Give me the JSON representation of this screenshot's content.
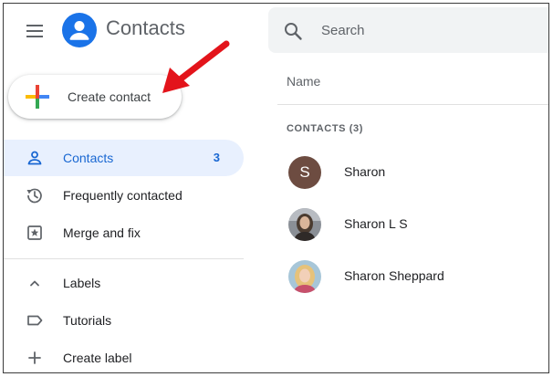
{
  "app": {
    "title": "Contacts"
  },
  "create_button": {
    "label": "Create contact"
  },
  "nav": {
    "contacts": {
      "label": "Contacts",
      "count": "3"
    },
    "frequently": {
      "label": "Frequently contacted"
    },
    "merge": {
      "label": "Merge and fix"
    },
    "labels_header": {
      "label": "Labels"
    },
    "tutorials": {
      "label": "Tutorials"
    },
    "create_label": {
      "label": "Create label"
    }
  },
  "search": {
    "placeholder": "Search",
    "value": ""
  },
  "list": {
    "column_header": "Name",
    "section_label": "CONTACTS (3)",
    "contacts": [
      {
        "name": "Sharon",
        "initial": "S"
      },
      {
        "name": "Sharon L S"
      },
      {
        "name": "Sharon Sheppard"
      }
    ]
  },
  "colors": {
    "accent": "#1a73e8",
    "active_bg": "#e8f0fe",
    "active_text": "#1967d2",
    "annotation_arrow": "#e3141b",
    "avatar_letter_bg": "#6d4c41"
  },
  "icons": {
    "menu": "hamburger-menu-icon",
    "logo": "contacts-logo-icon",
    "plus": "multicolor-plus-icon",
    "contacts": "person-outline-icon",
    "frequently": "history-icon",
    "merge": "merge-fix-icon",
    "labels": "chevron-up-icon",
    "tutorials": "label-outline-icon",
    "create_label": "plus-icon",
    "search": "search-icon"
  }
}
